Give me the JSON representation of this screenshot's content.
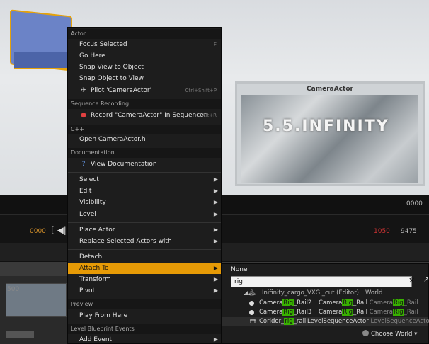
{
  "viewport": {
    "preview_title": "CameraActor",
    "preview_logo": "5.5.INFINITY",
    "time_left": "0000",
    "time_right_red": "1050",
    "time_right": "9475",
    "time_top_right": "0000",
    "ruler": "500"
  },
  "menu": {
    "sections": {
      "actor": "Actor",
      "sequence": "Sequence Recording",
      "cpp": "C++",
      "documentation": "Documentation",
      "preview": "Preview",
      "level_bp": "Level Blueprint Events"
    },
    "items": {
      "focus_selected": "Focus Selected",
      "focus_shortcut": "F",
      "go_here": "Go Here",
      "snap_view": "Snap View to Object",
      "snap_object": "Snap Object to View",
      "pilot": "Pilot 'CameraActor'",
      "pilot_shortcut": "Ctrl+Shift+P",
      "record": "Record \"CameraActor\" In Sequencer",
      "record_shortcut": "Alt+R",
      "open_h": "Open CameraActor.h",
      "view_docs": "View Documentation",
      "select": "Select",
      "edit": "Edit",
      "visibility": "Visibility",
      "level": "Level",
      "place_actor": "Place Actor",
      "replace_actors": "Replace Selected Actors with",
      "detach": "Detach",
      "attach_to": "Attach To",
      "transform": "Transform",
      "pivot": "Pivot",
      "play_from_here": "Play From Here",
      "add_event": "Add Event"
    },
    "accent_color": "#e69a06"
  },
  "submenu": {
    "none": "None",
    "search_value": "rig",
    "world_row": {
      "name": "Inifinity_cargo_VXGI_cut (Editor)",
      "type": "World"
    },
    "rows": [
      {
        "pre": "Camera",
        "match": "Rig",
        "post": "_Rail2",
        "type_pre": "Camera",
        "type_match": "Rig",
        "type_post": "_Rail",
        "type2_pre": "Camera",
        "type2_match": "Rig",
        "type2_post": "_Rail"
      },
      {
        "pre": "Camera",
        "match": "Rig",
        "post": "_Rail3",
        "type_pre": "Camera",
        "type_match": "Rig",
        "type_post": "_Rail",
        "type2_pre": "Camera",
        "type2_match": "Rig",
        "type2_post": "_Rail"
      },
      {
        "pre": "Coridor_",
        "match": "rig",
        "post": "_rail",
        "type_pre": "LevelSequenceActor",
        "type_match": "",
        "type_post": "",
        "type2_pre": "LevelSequenceActo",
        "type2_match": "",
        "type2_post": ""
      }
    ],
    "choose_world": "Choose World",
    "match_color": "#38b000"
  }
}
